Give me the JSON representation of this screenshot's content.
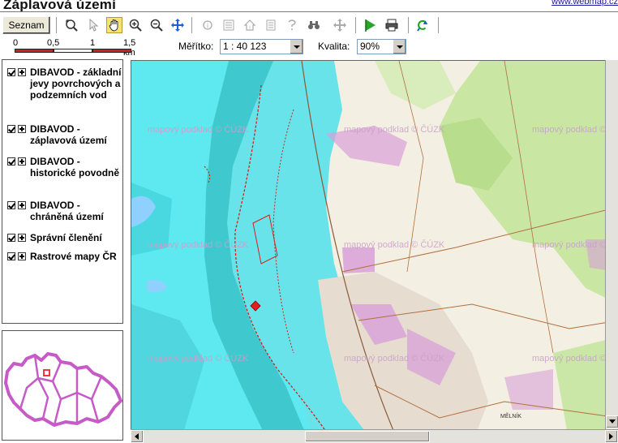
{
  "header": {
    "title": "Záplavová území",
    "link": "www.webmap.cz"
  },
  "toolbar": {
    "list_button": "Seznam",
    "tools": [
      {
        "icon": "zoom-reset-icon",
        "active": false
      },
      {
        "icon": "pointer-info-icon",
        "active": false
      },
      {
        "icon": "pan-hand-icon",
        "active": true
      },
      {
        "icon": "zoom-in-icon",
        "active": false
      },
      {
        "icon": "zoom-out-icon",
        "active": false
      },
      {
        "icon": "move-arrows-icon",
        "active": false
      },
      {
        "icon": "info-icon",
        "active": false
      },
      {
        "icon": "list-icon",
        "active": false
      },
      {
        "icon": "home-icon",
        "active": false
      },
      {
        "icon": "layers-icon",
        "active": false
      },
      {
        "icon": "help-icon",
        "active": false
      },
      {
        "icon": "binoculars-icon",
        "active": false
      },
      {
        "icon": "move-gray-icon",
        "active": false
      },
      {
        "icon": "flag-icon",
        "active": false
      },
      {
        "icon": "print-icon",
        "active": false
      },
      {
        "icon": "refresh-icon",
        "active": false
      }
    ]
  },
  "scalebar": {
    "labels": [
      "0",
      "0,5",
      "1",
      "1,5 km"
    ]
  },
  "scale": {
    "label": "Měřítko:",
    "value": "1 : 40 123"
  },
  "quality": {
    "label": "Kvalita:",
    "value": "90%"
  },
  "layers": [
    {
      "label": "DIBAVOD - základní jevy povrchových a podzemních vod",
      "checked": true
    },
    {
      "label": "DIBAVOD - záplavová území",
      "checked": true
    },
    {
      "label": "DIBAVOD - historické povodně",
      "checked": true
    },
    {
      "label": "DIBAVOD - chráněná území",
      "checked": true
    },
    {
      "label": "Správní členění",
      "checked": true
    },
    {
      "label": "Rastrové mapy ČR",
      "checked": true
    }
  ],
  "map": {
    "watermark": "mapový podklad © ČÚZK",
    "place_label": "MĚLNÍK",
    "colors": {
      "flood": "#5ee8f0",
      "flood_dark": "#3fc9cf",
      "river": "#2aa7c0",
      "green": "#bfe39a",
      "urban": "#c98ac9",
      "marker": "#e02020"
    }
  }
}
